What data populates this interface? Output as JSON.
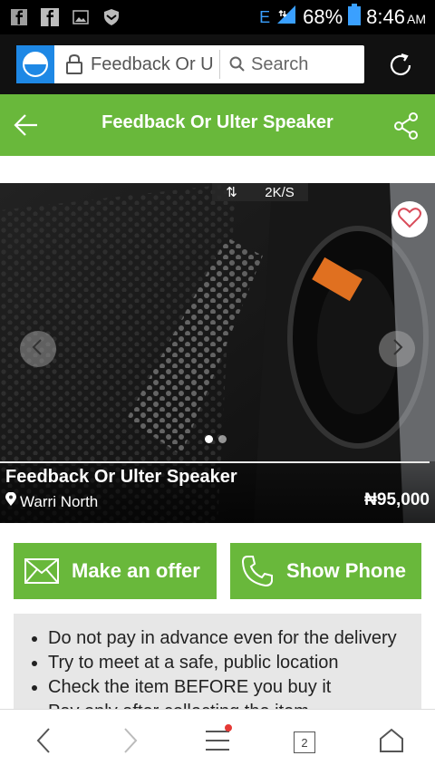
{
  "status": {
    "network": "E",
    "battery": "68%",
    "time": "8:46",
    "ampm": "AM"
  },
  "browser": {
    "url_text": "Feedback Or U",
    "search_placeholder": "Search"
  },
  "titlebar": {
    "title": "Feedback Or Ulter Speaker"
  },
  "image": {
    "speed": "2K/S"
  },
  "product": {
    "title": "Feedback Or Ulter Speaker",
    "location": "Warri North",
    "price": "₦95,000"
  },
  "actions": {
    "offer_label": "Make an offer",
    "phone_label": "Show Phone"
  },
  "tips": [
    "Do not pay in advance even for the delivery",
    "Try to meet at a safe, public location",
    "Check the item BEFORE you buy it",
    "Pay only after collecting the item"
  ],
  "bottombar": {
    "tab_count": "2"
  },
  "colors": {
    "accent": "#69b83b",
    "browser_bar": "#111111"
  }
}
